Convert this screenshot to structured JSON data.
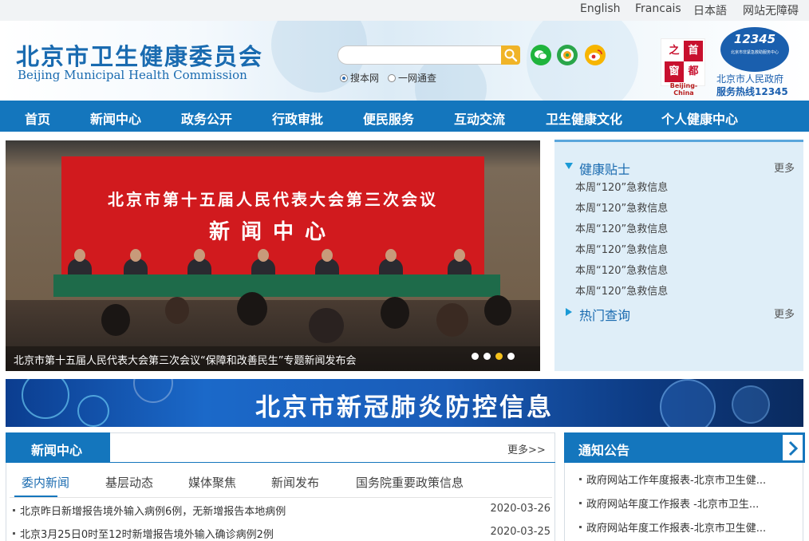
{
  "topbar": {
    "links": [
      "English",
      "Francais",
      "日本語",
      "网站无障碍"
    ]
  },
  "header": {
    "logo_cn": "北京市卫生健康委员会",
    "logo_en": "Beijing Municipal Health Commission",
    "search": {
      "placeholder": "",
      "scopes": [
        "搜本网",
        "一网通查"
      ],
      "selected_scope": "搜本网"
    },
    "social_icons": [
      "wechat-icon",
      "weibo-app-icon",
      "weibo-icon"
    ],
    "capital_badge": {
      "chars": [
        "首",
        "都",
        "之",
        "窗"
      ],
      "en": "Beijing-China"
    },
    "gov_hotline": {
      "number": "12345",
      "small": "北京市非紧急救助服务中心",
      "line1": "北京市人民政府",
      "line2": "服务热线12345"
    },
    "colors": {
      "brand": "#1a6bb0",
      "nav": "#1476bd",
      "search_btn": "#f0b428"
    }
  },
  "nav": {
    "items": [
      "首页",
      "新闻中心",
      "政务公开",
      "行政审批",
      "便民服务",
      "互动交流",
      "卫生健康文化",
      "个人健康中心"
    ]
  },
  "banner": {
    "wall_line1": "北京市第十五届人民代表大会第三次会议",
    "wall_line2": "新闻中心",
    "caption": "北京市第十五届人民代表大会第三次会议“保障和改善民生”专题新闻发布会",
    "dots": 4,
    "active_dot": 2
  },
  "panel": {
    "section1": {
      "title": "健康贴士",
      "more": "更多",
      "items": [
        "本周“120”急救信息",
        "本周“120”急救信息",
        "本周“120”急救信息",
        "本周“120”急救信息",
        "本周“120”急救信息",
        "本周“120”急救信息"
      ]
    },
    "section2": {
      "title": "热门查询",
      "more": "更多"
    }
  },
  "covid": {
    "title": "北京市新冠肺炎防控信息"
  },
  "news": {
    "title": "新闻中心",
    "more": "更多>>",
    "tabs": [
      "委内新闻",
      "基层动态",
      "媒体聚焦",
      "新闻发布",
      "国务院重要政策信息"
    ],
    "active_tab": 0,
    "rows": [
      {
        "text": "北京昨日新增报告境外输入病例6例，无新增报告本地病例",
        "date": "2020-03-26"
      },
      {
        "text": "北京3月25日0时至12时新增报告境外输入确诊病例2例",
        "date": "2020-03-25"
      }
    ]
  },
  "notice": {
    "title": "通知公告",
    "items": [
      "政府网站工作年度报表-北京市卫生健...",
      "政府网站年度工作报表 -北京市卫生...",
      "政府网站年度工作报表-北京市卫生健..."
    ]
  }
}
